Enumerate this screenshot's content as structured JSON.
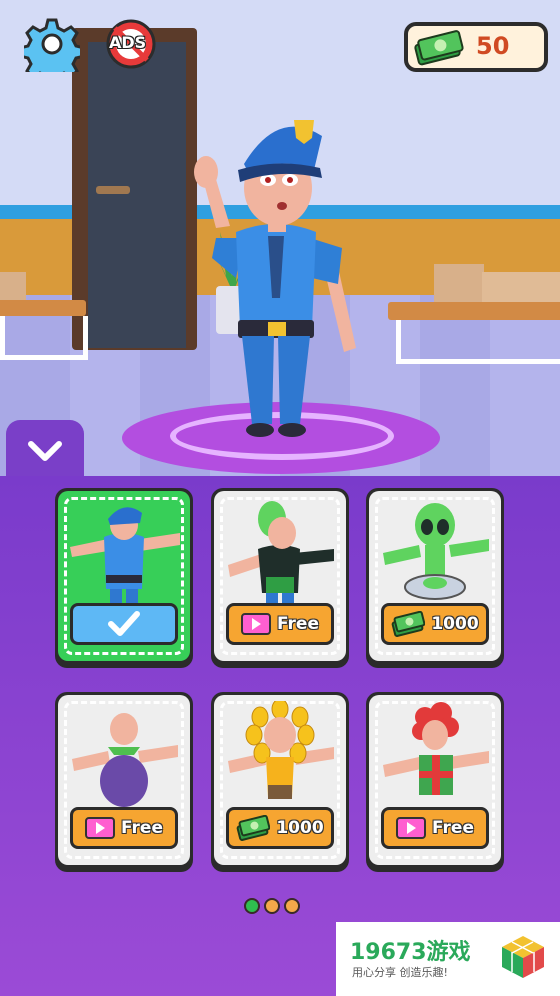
{
  "hud": {
    "settings_icon": "gear-icon",
    "no_ads_label": "ADS",
    "currency": {
      "icon": "cash-stack-icon",
      "value": "50"
    }
  },
  "panel": {
    "toggle_icon": "chevron-down-icon",
    "skins": [
      {
        "name": "police",
        "state": "selected",
        "action_icon": "checkmark-icon",
        "label": ""
      },
      {
        "name": "alien-hoodie",
        "state": "free",
        "action_icon": "video-ad-icon",
        "label": "Free"
      },
      {
        "name": "alien-ufo",
        "state": "price",
        "action_icon": "cash-stack-icon",
        "label": "1000"
      },
      {
        "name": "grape",
        "state": "free",
        "action_icon": "video-ad-icon",
        "label": "Free"
      },
      {
        "name": "sunflower",
        "state": "price",
        "action_icon": "cash-stack-icon",
        "label": "1000"
      },
      {
        "name": "gift-rose",
        "state": "free",
        "action_icon": "video-ad-icon",
        "label": "Free"
      }
    ],
    "pager": {
      "pages": 3,
      "current": 1,
      "colors": [
        "#2fbf4f",
        "#f3a94a",
        "#f3a94a"
      ]
    }
  },
  "watermark": {
    "brand": "19673游戏",
    "slogan": "用心分享 创造乐趣!"
  },
  "colors": {
    "panel_bg": "#7a3fc8",
    "selected_card": "#37cf58",
    "orange_button": "#f6a531",
    "blue_button": "#5eb8f5",
    "currency_text": "#d04a22"
  }
}
